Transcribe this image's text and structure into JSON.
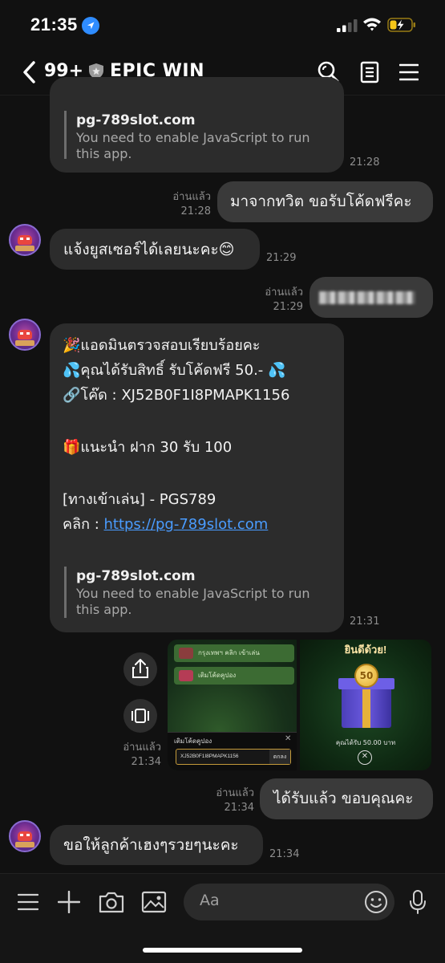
{
  "status_bar": {
    "time": "21:35",
    "battery_color": "#f5c518"
  },
  "header": {
    "back_count": "99+",
    "title": "EPIC WIN",
    "icons": [
      "chevron-left-icon",
      "shield-icon",
      "search-icon",
      "note-icon",
      "menu-icon"
    ]
  },
  "messages": {
    "m1": {
      "preview_title": "pg-789slot.com",
      "preview_desc": "You need to enable JavaScript to run\nthis app.",
      "time": "21:28"
    },
    "m2": {
      "read": "อ่านแล้ว",
      "time": "21:28",
      "text": "มาจากทวิต ขอรับโค้ดฟรีคะ"
    },
    "m3": {
      "text": "แจ้งยูสเซอร์ได้เลยนะคะ😊",
      "time": "21:29"
    },
    "m4": {
      "read": "อ่านแล้ว",
      "time": "21:29"
    },
    "m5": {
      "line1": "🎉แอดมินตรวจสอบเรียบร้อยคะ",
      "line2": "💦คุณได้รับสิทธิ์ รับโค้ดฟรี 50.- 💦",
      "line3": "🔗โค๊ด : XJ52B0F1I8PMAPK1156",
      "line4": "🎁แนะนำ ฝาก 30 รับ 100",
      "line5": "[ทางเข้าเล่น] - PGS789",
      "line6_prefix": "คลิก : ",
      "line6_link": "https://pg-789slot.com",
      "preview_title": "pg-789slot.com",
      "preview_desc": "You need to enable JavaScript to run\nthis app.",
      "time": "21:31"
    },
    "m6": {
      "read": "อ่านแล้ว",
      "time": "21:34",
      "img1": {
        "row1": "กรุงเทพฯ คลิก เข้าเล่น",
        "row2": "เติมโค้ดคูปอง",
        "dialog_title": "เติมโค้ดคูปอง",
        "code": "XJ52B0F1I8PMAPK1156",
        "btn": "ตกลง"
      },
      "img2": {
        "banner": "ยินดีด้วย!",
        "coin": "50",
        "amount": "คุณได้รับ 50.00 บาท"
      }
    },
    "m7": {
      "read": "อ่านแล้ว",
      "time": "21:34",
      "text": "ได้รับแล้ว ขอบคุณคะ"
    },
    "m8": {
      "text": "ขอให้ลูกค้าเฮงๆรวยๆนะคะ",
      "time": "21:34"
    }
  },
  "input": {
    "placeholder": "Aa"
  }
}
